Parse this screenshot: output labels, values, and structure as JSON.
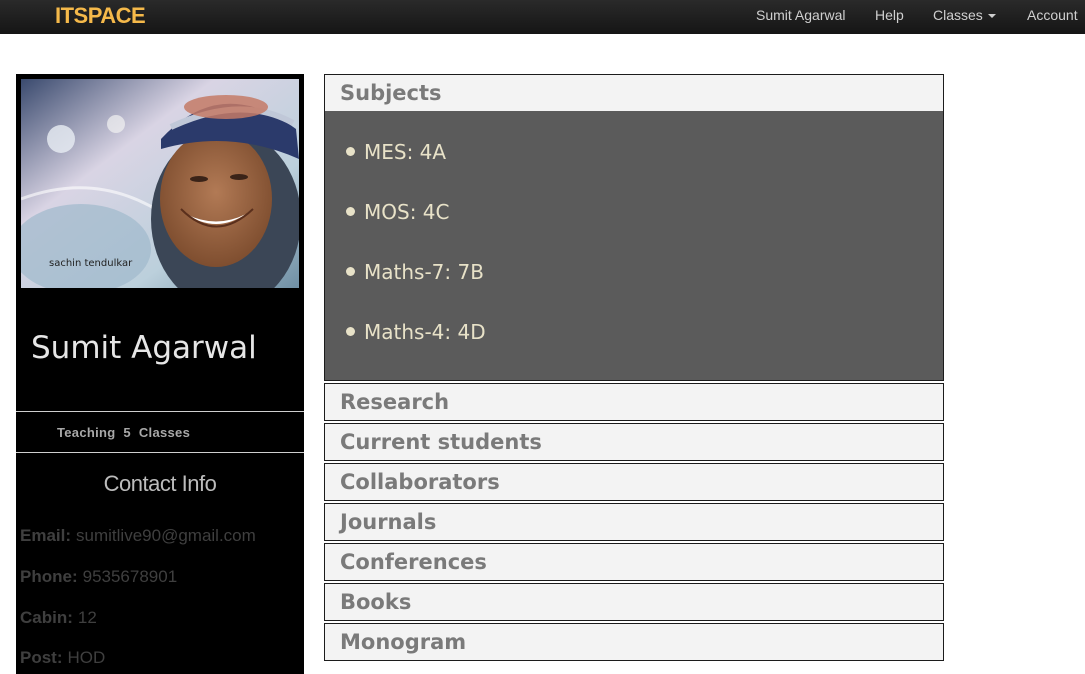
{
  "navbar": {
    "brand": "ITSPACE",
    "user": "Sumit Agarwal",
    "help": "Help",
    "classes": "Classes",
    "account": "Account"
  },
  "profile": {
    "photo_caption": "sachin tendulkar",
    "name": "Sumit Agarwal",
    "teaching": "Teaching 5 Classes",
    "contact_title": "Contact Info",
    "contact": [
      {
        "label": "Email:",
        "value": "sumitlive90@gmail.com"
      },
      {
        "label": "Phone:",
        "value": "9535678901"
      },
      {
        "label": "Cabin:",
        "value": "12"
      },
      {
        "label": "Post:",
        "value": "HOD"
      }
    ]
  },
  "sections": {
    "subjects": "Subjects",
    "research": "Research",
    "current_students": "Current students",
    "collaborators": "Collaborators",
    "journals": "Journals",
    "conferences": "Conferences",
    "books": "Books",
    "monogram": "Monogram"
  },
  "subjects": [
    "MES: 4A",
    "MOS: 4C",
    "Maths-7: 7B",
    "Maths-4: 4D"
  ]
}
